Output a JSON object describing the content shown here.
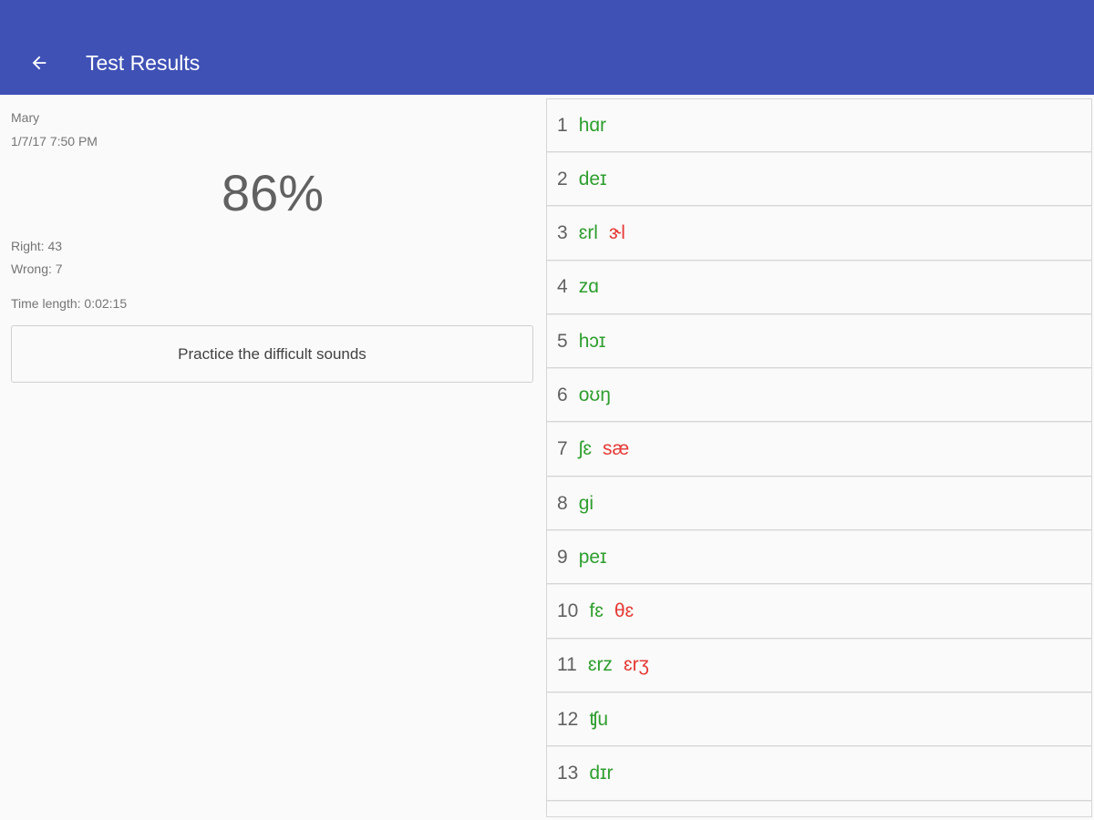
{
  "header": {
    "title": "Test Results",
    "back_icon": "arrow-left-icon"
  },
  "summary": {
    "name": "Mary",
    "datetime": "1/7/17 7:50 PM",
    "score": "86%",
    "right": "Right: 43",
    "wrong": "Wrong: 7",
    "time_length": "Time length: 0:02:15",
    "practice_label": "Practice the difficult sounds"
  },
  "colors": {
    "appbar": "#3f51b5",
    "correct": "#2e9e2e",
    "incorrect": "#e53935"
  },
  "results": [
    {
      "num": "1",
      "answer": "hɑr",
      "wrong": ""
    },
    {
      "num": "2",
      "answer": "deɪ",
      "wrong": ""
    },
    {
      "num": "3",
      "answer": "ɛrl",
      "wrong": "ɝl"
    },
    {
      "num": "4",
      "answer": "zɑ",
      "wrong": ""
    },
    {
      "num": "5",
      "answer": "hɔɪ",
      "wrong": ""
    },
    {
      "num": "6",
      "answer": "oʊŋ",
      "wrong": ""
    },
    {
      "num": "7",
      "answer": "ʃɛ",
      "wrong": "sæ"
    },
    {
      "num": "8",
      "answer": "gi",
      "wrong": ""
    },
    {
      "num": "9",
      "answer": "peɪ",
      "wrong": ""
    },
    {
      "num": "10",
      "answer": "fɛ",
      "wrong": "θɛ"
    },
    {
      "num": "11",
      "answer": "ɛrz",
      "wrong": "ɛrʒ"
    },
    {
      "num": "12",
      "answer": "ʧu",
      "wrong": ""
    },
    {
      "num": "13",
      "answer": "dɪr",
      "wrong": ""
    }
  ]
}
